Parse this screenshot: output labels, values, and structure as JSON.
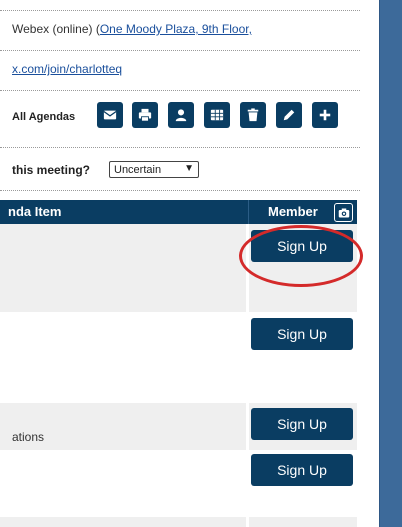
{
  "meeting": {
    "location_prefix": "Webex (online) (",
    "location_link": "One Moody Plaza, 9th Floor,",
    "join_link": "x.com/join/charlotteq"
  },
  "toolbar": {
    "label": "All Agendas",
    "icons": [
      "envelope-icon",
      "printer-icon",
      "user-icon",
      "table-icon",
      "trash-icon",
      "pencil-icon",
      "plus-icon"
    ]
  },
  "attendance": {
    "question": "this meeting?",
    "selected": "Uncertain"
  },
  "table": {
    "col_agenda": "nda Item",
    "col_member": "Member"
  },
  "rows": [
    {
      "text": "",
      "button": "Sign Up"
    },
    {
      "text": "",
      "button": "Sign Up"
    },
    {
      "text": "ations",
      "button": "Sign Up"
    },
    {
      "text": "",
      "button": "Sign Up"
    }
  ],
  "colors": {
    "primary": "#0a3d62",
    "highlight": "#d42a2a",
    "sidebar": "#3d6a9a"
  }
}
